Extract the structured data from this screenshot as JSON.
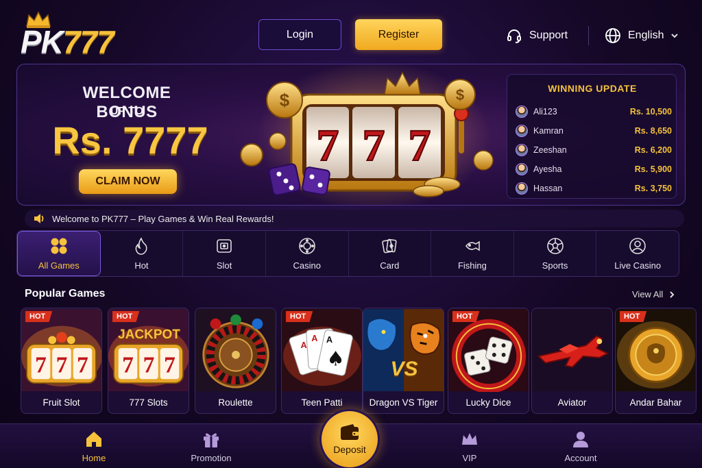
{
  "brand": {
    "logo_pk": "PK",
    "logo_num": "777"
  },
  "header": {
    "login_label": "Login",
    "register_label": "Register",
    "support_label": "Support",
    "language_label": "English"
  },
  "hero": {
    "title": "WELCOME BONUS",
    "subtitle": "UP TO",
    "amount": "Rs. 7777",
    "cta": "CLAIM NOW"
  },
  "winning_update": {
    "title": "WINNING UPDATE",
    "rows": [
      {
        "name": "Ali123",
        "amount": "Rs. 10,500"
      },
      {
        "name": "Kamran",
        "amount": "Rs. 8,650"
      },
      {
        "name": "Zeeshan",
        "amount": "Rs. 6,200"
      },
      {
        "name": "Ayesha",
        "amount": "Rs. 5,900"
      },
      {
        "name": "Hassan",
        "amount": "Rs. 3,750"
      }
    ]
  },
  "marquee": {
    "text": "Welcome to PK777 – Play Games & Win Real Rewards!"
  },
  "categories": [
    {
      "label": "All Games",
      "icon": "grid-icon",
      "active": true
    },
    {
      "label": "Hot",
      "icon": "flame-icon"
    },
    {
      "label": "Slot",
      "icon": "slot-icon"
    },
    {
      "label": "Casino",
      "icon": "chip-icon"
    },
    {
      "label": "Card",
      "icon": "cards-icon"
    },
    {
      "label": "Fishing",
      "icon": "fish-icon"
    },
    {
      "label": "Sports",
      "icon": "soccer-ball-icon"
    },
    {
      "label": "Live Casino",
      "icon": "live-dealer-icon"
    }
  ],
  "popular": {
    "title": "Popular Games",
    "view_all": "View All",
    "games": [
      {
        "name": "Fruit Slot",
        "badge": "HOT"
      },
      {
        "name": "777 Slots",
        "badge": "HOT",
        "art_text": "JACKPOT"
      },
      {
        "name": "Roulette"
      },
      {
        "name": "Teen Patti",
        "badge": "HOT"
      },
      {
        "name": "Dragon VS Tiger",
        "art_text": "VS"
      },
      {
        "name": "Lucky Dice",
        "badge": "HOT"
      },
      {
        "name": "Aviator"
      },
      {
        "name": "Andar Bahar",
        "badge": "HOT"
      }
    ]
  },
  "bottom_nav": {
    "home": "Home",
    "promotion": "Promotion",
    "deposit": "Deposit",
    "vip": "VIP",
    "account": "Account"
  },
  "colors": {
    "accent": "#f6c23c",
    "hot_badge": "#d8301c",
    "background": "#150826"
  }
}
